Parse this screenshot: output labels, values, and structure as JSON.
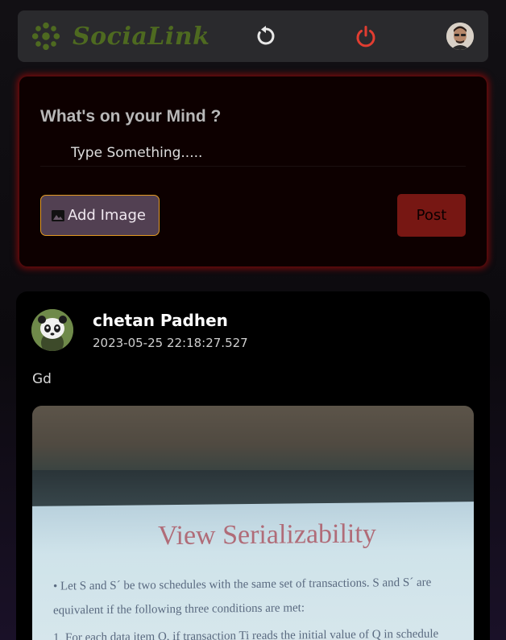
{
  "app": {
    "name": "SociaLink"
  },
  "compose": {
    "title": "What's on your Mind ?",
    "placeholder": "Type Something.....",
    "add_image_label": "Add Image",
    "post_label": "Post"
  },
  "post": {
    "author": "chetan Padhen",
    "timestamp": "2023-05-25 22:18:27.527",
    "text": "Gd",
    "image": {
      "slide_title": "View Serializability",
      "line1": "•   Let S and S´ be two schedules with the same set of transactions.  S and S´ are",
      "line2": "equivalent if the following three conditions are met:",
      "line3": "1.   For each data item Q, if transaction Ti reads the initial value of Q in schedule"
    }
  },
  "icons": {
    "logo": "flower-logo-icon",
    "refresh": "refresh-icon",
    "power": "power-icon",
    "add_image": "image-icon"
  },
  "colors": {
    "accent_red": "#e23d31",
    "logo_green": "#4e6a20",
    "add_image_border": "#e39a22",
    "post_button": "#771713"
  }
}
